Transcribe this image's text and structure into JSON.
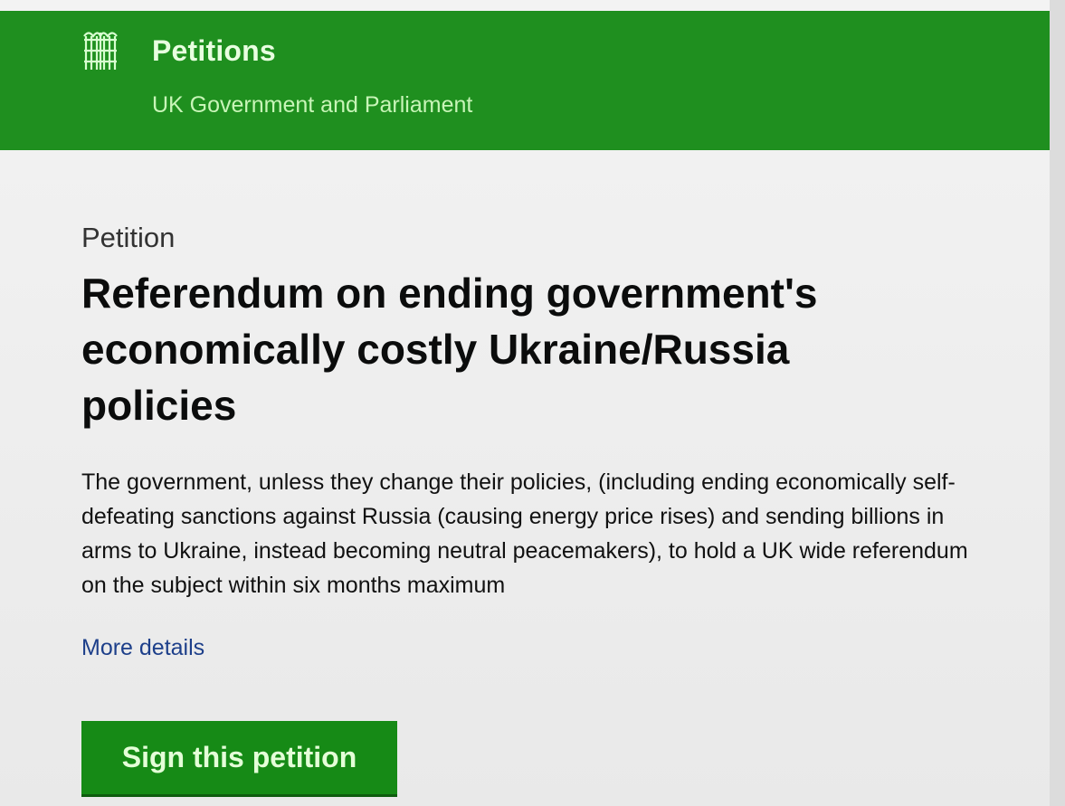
{
  "header": {
    "logo_icon": "portcullis-icon",
    "title": "Petitions",
    "subtitle": "UK Government and Parliament",
    "background_color": "#1f8f1f"
  },
  "petition": {
    "kicker": "Petition",
    "title": "Referendum on ending government's economically costly Ukraine/Russia policies",
    "summary": "The government, unless they change their policies, (including ending economically self-defeating sanctions against Russia (causing energy price rises) and sending billions in arms to Ukraine, instead becoming neutral peacemakers), to hold a UK wide referendum on the subject within six months maximum",
    "more_details_label": "More details"
  },
  "actions": {
    "sign_label": "Sign this petition",
    "button_color": "#168a16"
  }
}
